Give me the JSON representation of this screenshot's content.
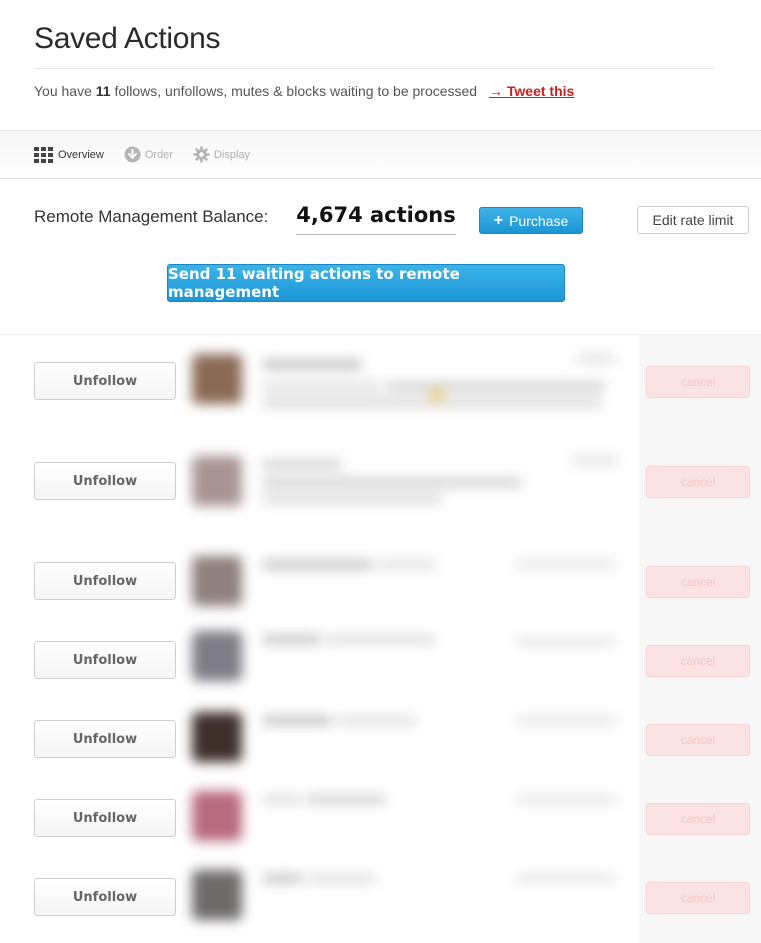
{
  "page": {
    "title": "Saved Actions",
    "summary": {
      "prefix": "You have ",
      "count": "11",
      "suffix": " follows, unfollows, mutes & blocks waiting to be processed",
      "tweet_link": "→ Tweet this"
    }
  },
  "toolbar": {
    "items": [
      {
        "label": "Overview",
        "icon": "grid-icon",
        "active": true
      },
      {
        "label": "Order",
        "icon": "arrow-down-circle-icon",
        "active": false
      },
      {
        "label": "Display",
        "icon": "gear-icon",
        "active": false
      }
    ]
  },
  "balance": {
    "label": "Remote Management Balance:",
    "value": "4,674 actions",
    "purchase_plus": "+",
    "purchase_label": "Purchase",
    "rate_limit_label": "Edit rate limit"
  },
  "send_button": "Send 11 waiting actions to remote management",
  "rows": [
    {
      "action": "Unfollow",
      "cancel": "cancel"
    },
    {
      "action": "Unfollow",
      "cancel": "cancel"
    },
    {
      "action": "Unfollow",
      "cancel": "cancel"
    },
    {
      "action": "Unfollow",
      "cancel": "cancel"
    },
    {
      "action": "Unfollow",
      "cancel": "cancel"
    },
    {
      "action": "Unfollow",
      "cancel": "cancel"
    },
    {
      "action": "Unfollow",
      "cancel": "cancel"
    }
  ],
  "colors": {
    "accent_blue": "#2aa6e0",
    "link_red": "#cc1f1f",
    "cancel_pink": "#fbe3e3"
  }
}
